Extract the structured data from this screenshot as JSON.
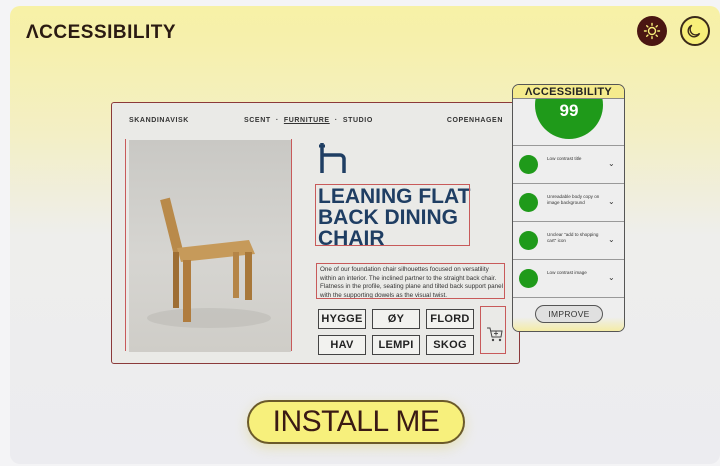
{
  "app": {
    "brand": "ΛCCESSIBILITY",
    "theme_light_icon": "sun-icon",
    "theme_dark_icon": "moon-icon"
  },
  "site": {
    "nav": {
      "brand": "SKANDINAVISK",
      "links": [
        "SCENT",
        "FURNITURE",
        "STUDIO"
      ],
      "active": "FURNITURE",
      "city": "COPENHAGEN"
    },
    "product": {
      "logo_icon": "chair-logo-icon",
      "title_lines": [
        "LEANING FLAT",
        "BACK DINING",
        "CHAIR"
      ],
      "description": "One of our foundation chair silhouettes focused on versatility within an interior. The inclined partner to the straight back chair. Flatness in the profile, seating plane and tilted back support panel with the supporting dowels as the visual twist.",
      "tags": [
        "HYGGE",
        "ØY",
        "FLORD",
        "HAV",
        "LEMPI",
        "SKOG"
      ],
      "cart_icon": "add-to-cart-icon"
    }
  },
  "panel": {
    "title": "ΛCCESSIBILITY",
    "score": "99",
    "issues": [
      "Low contrast title",
      "Unreadable body copy on image background",
      "Unclear \"add to shopping cart\" icon",
      "Low contrast image"
    ],
    "improve_label": "IMPROVE"
  },
  "cta": {
    "install_label": "INSTALL ME"
  },
  "colors": {
    "score_green": "#1f9a1a",
    "title_blue": "#1f3e63",
    "accent_yellow": "#f7f07c",
    "dark_brown": "#4a1612"
  }
}
